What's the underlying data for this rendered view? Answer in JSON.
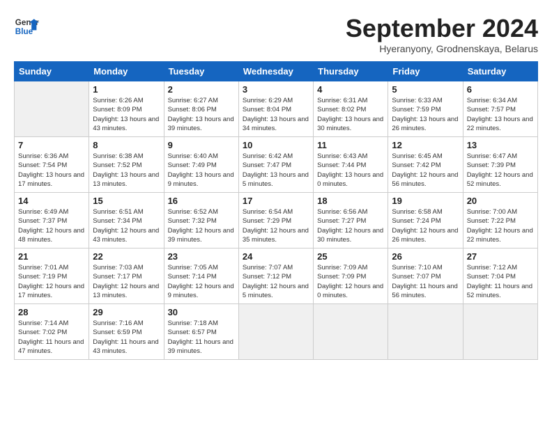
{
  "header": {
    "logo_line1": "General",
    "logo_line2": "Blue",
    "month_title": "September 2024",
    "location": "Hyeranyony, Grodnenskaya, Belarus"
  },
  "weekdays": [
    "Sunday",
    "Monday",
    "Tuesday",
    "Wednesday",
    "Thursday",
    "Friday",
    "Saturday"
  ],
  "days": [
    {
      "num": "",
      "empty": true
    },
    {
      "num": "1",
      "sunrise": "Sunrise: 6:26 AM",
      "sunset": "Sunset: 8:09 PM",
      "daylight": "Daylight: 13 hours and 43 minutes."
    },
    {
      "num": "2",
      "sunrise": "Sunrise: 6:27 AM",
      "sunset": "Sunset: 8:06 PM",
      "daylight": "Daylight: 13 hours and 39 minutes."
    },
    {
      "num": "3",
      "sunrise": "Sunrise: 6:29 AM",
      "sunset": "Sunset: 8:04 PM",
      "daylight": "Daylight: 13 hours and 34 minutes."
    },
    {
      "num": "4",
      "sunrise": "Sunrise: 6:31 AM",
      "sunset": "Sunset: 8:02 PM",
      "daylight": "Daylight: 13 hours and 30 minutes."
    },
    {
      "num": "5",
      "sunrise": "Sunrise: 6:33 AM",
      "sunset": "Sunset: 7:59 PM",
      "daylight": "Daylight: 13 hours and 26 minutes."
    },
    {
      "num": "6",
      "sunrise": "Sunrise: 6:34 AM",
      "sunset": "Sunset: 7:57 PM",
      "daylight": "Daylight: 13 hours and 22 minutes."
    },
    {
      "num": "7",
      "sunrise": "Sunrise: 6:36 AM",
      "sunset": "Sunset: 7:54 PM",
      "daylight": "Daylight: 13 hours and 17 minutes."
    },
    {
      "num": "8",
      "sunrise": "Sunrise: 6:38 AM",
      "sunset": "Sunset: 7:52 PM",
      "daylight": "Daylight: 13 hours and 13 minutes."
    },
    {
      "num": "9",
      "sunrise": "Sunrise: 6:40 AM",
      "sunset": "Sunset: 7:49 PM",
      "daylight": "Daylight: 13 hours and 9 minutes."
    },
    {
      "num": "10",
      "sunrise": "Sunrise: 6:42 AM",
      "sunset": "Sunset: 7:47 PM",
      "daylight": "Daylight: 13 hours and 5 minutes."
    },
    {
      "num": "11",
      "sunrise": "Sunrise: 6:43 AM",
      "sunset": "Sunset: 7:44 PM",
      "daylight": "Daylight: 13 hours and 0 minutes."
    },
    {
      "num": "12",
      "sunrise": "Sunrise: 6:45 AM",
      "sunset": "Sunset: 7:42 PM",
      "daylight": "Daylight: 12 hours and 56 minutes."
    },
    {
      "num": "13",
      "sunrise": "Sunrise: 6:47 AM",
      "sunset": "Sunset: 7:39 PM",
      "daylight": "Daylight: 12 hours and 52 minutes."
    },
    {
      "num": "14",
      "sunrise": "Sunrise: 6:49 AM",
      "sunset": "Sunset: 7:37 PM",
      "daylight": "Daylight: 12 hours and 48 minutes."
    },
    {
      "num": "15",
      "sunrise": "Sunrise: 6:51 AM",
      "sunset": "Sunset: 7:34 PM",
      "daylight": "Daylight: 12 hours and 43 minutes."
    },
    {
      "num": "16",
      "sunrise": "Sunrise: 6:52 AM",
      "sunset": "Sunset: 7:32 PM",
      "daylight": "Daylight: 12 hours and 39 minutes."
    },
    {
      "num": "17",
      "sunrise": "Sunrise: 6:54 AM",
      "sunset": "Sunset: 7:29 PM",
      "daylight": "Daylight: 12 hours and 35 minutes."
    },
    {
      "num": "18",
      "sunrise": "Sunrise: 6:56 AM",
      "sunset": "Sunset: 7:27 PM",
      "daylight": "Daylight: 12 hours and 30 minutes."
    },
    {
      "num": "19",
      "sunrise": "Sunrise: 6:58 AM",
      "sunset": "Sunset: 7:24 PM",
      "daylight": "Daylight: 12 hours and 26 minutes."
    },
    {
      "num": "20",
      "sunrise": "Sunrise: 7:00 AM",
      "sunset": "Sunset: 7:22 PM",
      "daylight": "Daylight: 12 hours and 22 minutes."
    },
    {
      "num": "21",
      "sunrise": "Sunrise: 7:01 AM",
      "sunset": "Sunset: 7:19 PM",
      "daylight": "Daylight: 12 hours and 17 minutes."
    },
    {
      "num": "22",
      "sunrise": "Sunrise: 7:03 AM",
      "sunset": "Sunset: 7:17 PM",
      "daylight": "Daylight: 12 hours and 13 minutes."
    },
    {
      "num": "23",
      "sunrise": "Sunrise: 7:05 AM",
      "sunset": "Sunset: 7:14 PM",
      "daylight": "Daylight: 12 hours and 9 minutes."
    },
    {
      "num": "24",
      "sunrise": "Sunrise: 7:07 AM",
      "sunset": "Sunset: 7:12 PM",
      "daylight": "Daylight: 12 hours and 5 minutes."
    },
    {
      "num": "25",
      "sunrise": "Sunrise: 7:09 AM",
      "sunset": "Sunset: 7:09 PM",
      "daylight": "Daylight: 12 hours and 0 minutes."
    },
    {
      "num": "26",
      "sunrise": "Sunrise: 7:10 AM",
      "sunset": "Sunset: 7:07 PM",
      "daylight": "Daylight: 11 hours and 56 minutes."
    },
    {
      "num": "27",
      "sunrise": "Sunrise: 7:12 AM",
      "sunset": "Sunset: 7:04 PM",
      "daylight": "Daylight: 11 hours and 52 minutes."
    },
    {
      "num": "28",
      "sunrise": "Sunrise: 7:14 AM",
      "sunset": "Sunset: 7:02 PM",
      "daylight": "Daylight: 11 hours and 47 minutes."
    },
    {
      "num": "29",
      "sunrise": "Sunrise: 7:16 AM",
      "sunset": "Sunset: 6:59 PM",
      "daylight": "Daylight: 11 hours and 43 minutes."
    },
    {
      "num": "30",
      "sunrise": "Sunrise: 7:18 AM",
      "sunset": "Sunset: 6:57 PM",
      "daylight": "Daylight: 11 hours and 39 minutes."
    },
    {
      "num": "",
      "empty": true
    },
    {
      "num": "",
      "empty": true
    },
    {
      "num": "",
      "empty": true
    },
    {
      "num": "",
      "empty": true
    }
  ]
}
